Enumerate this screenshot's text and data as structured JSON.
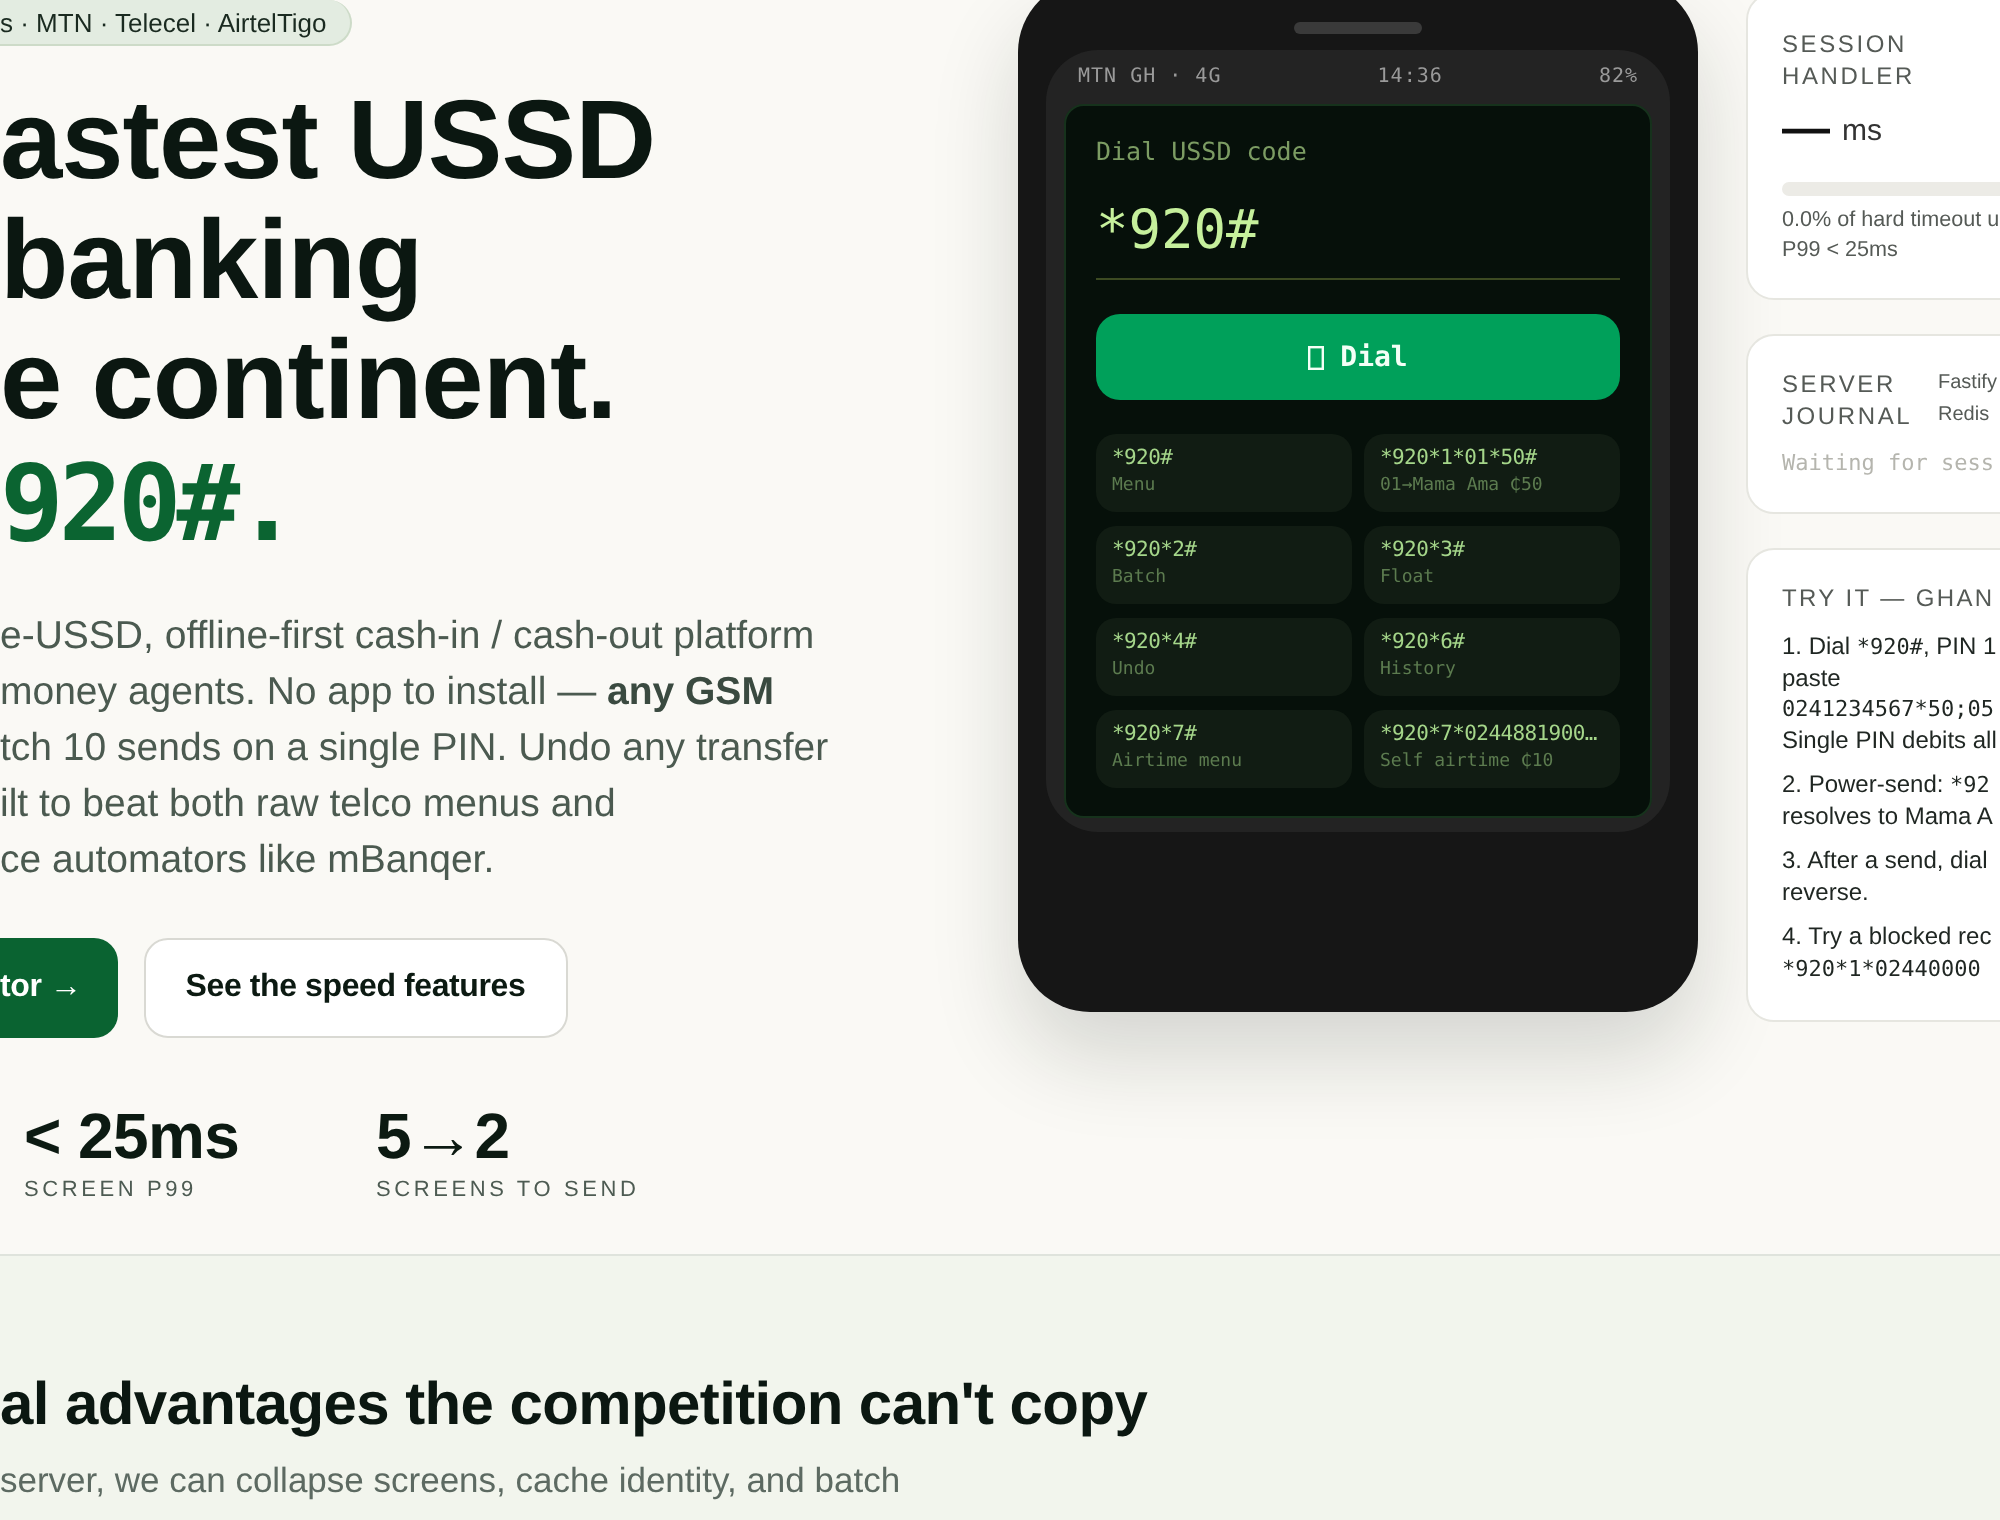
{
  "hero": {
    "badge": "s · MTN · Telecel · AirtelTigo",
    "headline_lines": [
      "astest USSD",
      "banking",
      "e continent."
    ],
    "headline_code": "920#.",
    "description_lines": [
      "e-USSD, offline-first cash-in / cash-out platform",
      "money agents. No app to install — **any GSM**",
      "tch 10 sends on a single PIN. Undo any transfer",
      "ilt to beat both raw telco menus and",
      "ce automators like mBanqer."
    ],
    "buttons": [
      {
        "label": "tor →",
        "kind": "primary"
      },
      {
        "label": "See the speed features",
        "kind": "secondary"
      }
    ],
    "stats": [
      {
        "value": "< 25ms",
        "label": "SCREEN P99"
      },
      {
        "value": "5→2",
        "label": "SCREENS TO SEND"
      }
    ]
  },
  "phone": {
    "status_bar": {
      "carrier": "MTN GH · 4G",
      "time": "14:36",
      "battery": "82%"
    },
    "dial_label": "Dial USSD code",
    "dial_value": "*920#",
    "dial_button": "Dial",
    "shortcuts": [
      {
        "code": "*920#",
        "label": "Menu"
      },
      {
        "code": "*920*1*01*50#",
        "label": "01→Mama Ama ₵50"
      },
      {
        "code": "*920*2#",
        "label": "Batch"
      },
      {
        "code": "*920*3#",
        "label": "Float"
      },
      {
        "code": "*920*4#",
        "label": "Undo"
      },
      {
        "code": "*920*6#",
        "label": "History"
      },
      {
        "code": "*920*7#",
        "label": "Airtime menu"
      },
      {
        "code": "*920*7*0244881900…",
        "label": "Self airtime ₵10"
      }
    ]
  },
  "session_handler": {
    "title": "SESSION HANDLER",
    "value": "—",
    "unit": "ms",
    "caption": "0.0% of hard timeout u",
    "target": "P99 < 25ms"
  },
  "server_journal": {
    "title": "SERVER JOURNAL",
    "stack_lines": [
      "Fastify",
      "Redis"
    ],
    "log": "Waiting for sess"
  },
  "try_it": {
    "title": "TRY IT — GHAN",
    "steps": [
      {
        "lines": [
          [
            {
              "kind": "text",
              "text": "1. Dial "
            },
            {
              "kind": "code",
              "text": "*920#"
            },
            {
              "kind": "text",
              "text": ", PIN 1"
            }
          ],
          [
            {
              "kind": "text",
              "text": "paste"
            }
          ],
          [
            {
              "kind": "code",
              "text": "0241234567*50;05"
            }
          ],
          [
            {
              "kind": "text",
              "text": "Single PIN debits all"
            }
          ]
        ]
      },
      {
        "lines": [
          [
            {
              "kind": "text",
              "text": "2. Power-send: "
            },
            {
              "kind": "code",
              "text": "*92"
            }
          ],
          [
            {
              "kind": "text",
              "text": "resolves to Mama A"
            }
          ]
        ]
      },
      {
        "lines": [
          [
            {
              "kind": "text",
              "text": "3. After a send, dial"
            }
          ],
          [
            {
              "kind": "text",
              "text": "reverse."
            }
          ]
        ]
      },
      {
        "lines": [
          [
            {
              "kind": "text",
              "text": "4. Try a blocked rec"
            }
          ],
          [
            {
              "kind": "code",
              "text": "*920*1*02440000"
            }
          ]
        ]
      }
    ]
  },
  "section": {
    "heading": "al advantages the competition can't copy",
    "lead": "server, we can collapse screens, cache identity, and batch"
  }
}
